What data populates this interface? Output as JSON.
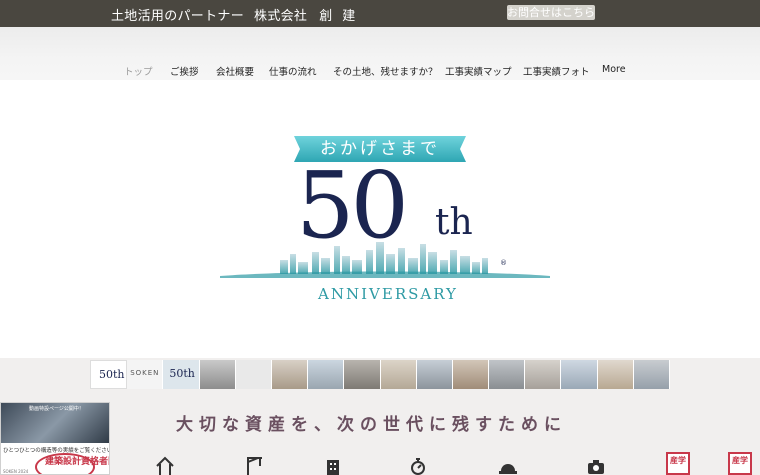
{
  "header": {
    "tagline": "土地活用のパートナー",
    "company_prefix": "株式会社",
    "company_name": "創建",
    "contact_button": "お問合せはこちら"
  },
  "nav": {
    "items": [
      {
        "label": "トップ",
        "active": true
      },
      {
        "label": "ご挨拶",
        "active": false
      },
      {
        "label": "会社概要",
        "active": false
      },
      {
        "label": "仕事の流れ",
        "active": false
      },
      {
        "label": "その土地、残せますか？",
        "active": false
      },
      {
        "label": "工事実績マップ",
        "active": false
      },
      {
        "label": "工事実績フォト",
        "active": false
      },
      {
        "label": "More",
        "active": false
      }
    ]
  },
  "hero": {
    "ribbon": "おかげさまで",
    "number": "50",
    "suffix": "th",
    "registered": "®",
    "anniversary": "ANNIVERSARY"
  },
  "gallery": {
    "thumb1": "50th",
    "thumb2": "SOKEN",
    "thumb3": "50th"
  },
  "main": {
    "tagline": "大切な資産を、次の世代に残すために"
  },
  "side_ad": {
    "headline": "動画特設ページ公開中！",
    "line": "ひとつひとつの構造等の実績をご覧ください",
    "stamp": "建築設計資格者限定",
    "footer": "SOKEN 2024"
  },
  "icons": [
    "house-icon",
    "crane-icon",
    "building-icon",
    "timer-icon",
    "helmet-icon",
    "camera-icon"
  ],
  "stamps": [
    "産学",
    "産学"
  ],
  "colors": {
    "topbar": "#4a4740",
    "ribbon": "#3fb7c3",
    "navy": "#1b2550",
    "teal": "#2e9aa4",
    "tagline": "#6a5060",
    "stamp": "#c8384a"
  }
}
